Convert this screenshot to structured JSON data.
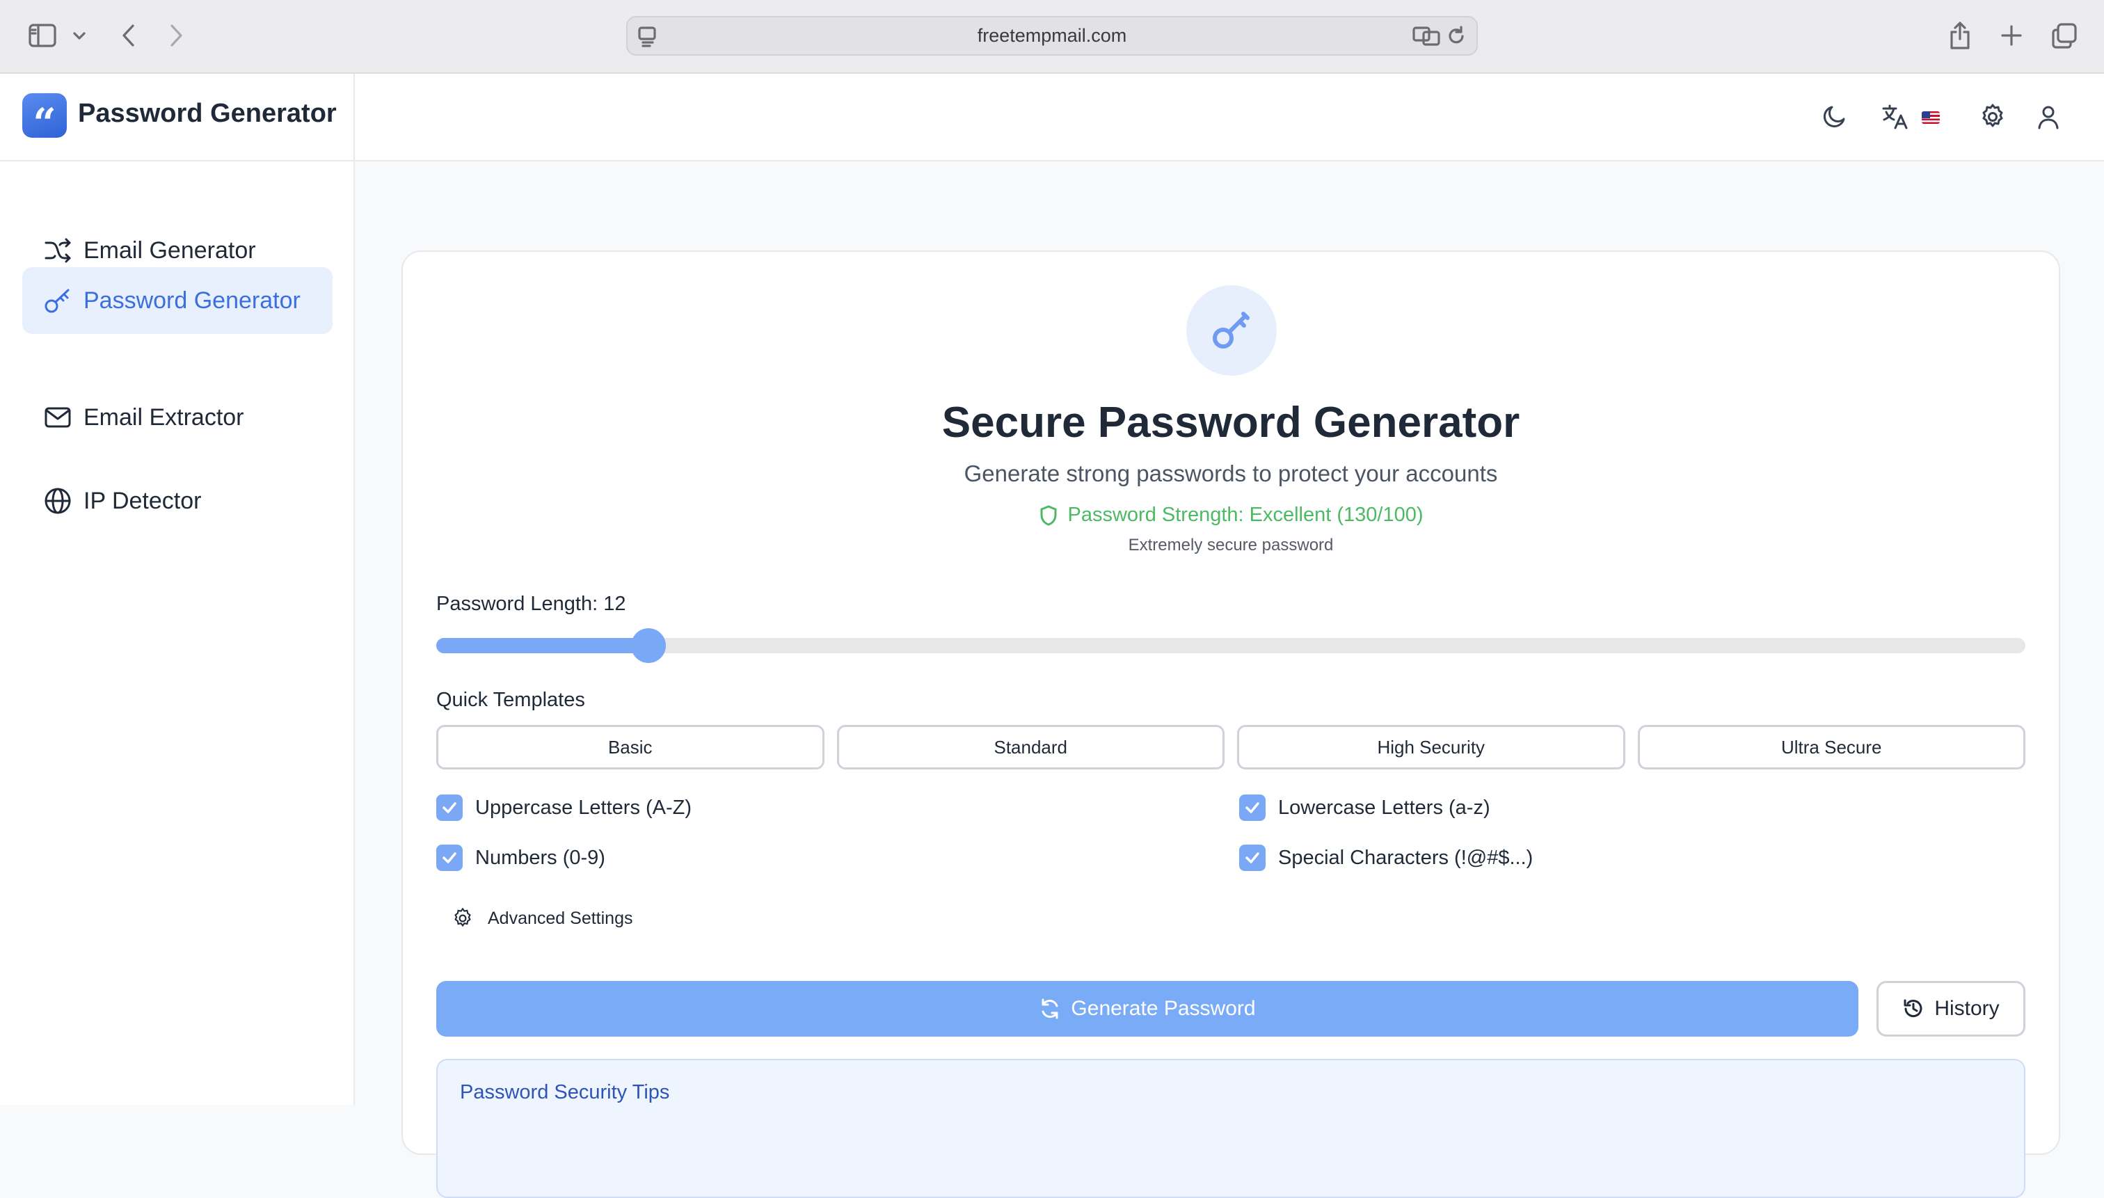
{
  "browser": {
    "url": "freetempmail.com"
  },
  "app": {
    "title": "Password Generator"
  },
  "header": {
    "icons": [
      "moon-icon",
      "translate-icon",
      "us-flag-icon",
      "gear-icon",
      "user-icon"
    ]
  },
  "sidebar": {
    "items": [
      {
        "label": "Email Generator",
        "icon": "shuffle-icon",
        "active": false
      },
      {
        "label": "Password Generator",
        "icon": "key-icon",
        "active": true
      },
      {
        "label": "Email Extractor",
        "icon": "mail-icon",
        "active": false
      },
      {
        "label": "IP Detector",
        "icon": "globe-icon",
        "active": false
      }
    ]
  },
  "main": {
    "title": "Secure Password Generator",
    "subtitle": "Generate strong passwords to protect your accounts",
    "strength_text": "Password Strength: Excellent (130/100)",
    "strength_note": "Extremely secure password",
    "strength_color": "#4cba62",
    "length_label": "Password Length: 12",
    "length_slider": {
      "value": 12,
      "min": 4,
      "max": 64
    },
    "templates_label": "Quick Templates",
    "templates": [
      "Basic",
      "Standard",
      "High Security",
      "Ultra Secure"
    ],
    "options": [
      {
        "label": "Uppercase Letters (A-Z)",
        "checked": true
      },
      {
        "label": "Lowercase Letters (a-z)",
        "checked": true
      },
      {
        "label": "Numbers (0-9)",
        "checked": true
      },
      {
        "label": "Special Characters (!@#$...)",
        "checked": true
      }
    ],
    "advanced_label": "Advanced Settings",
    "generate_label": "Generate Password",
    "history_label": "History",
    "tips_title": "Password Security Tips"
  },
  "colors": {
    "accent": "#3b6fe0",
    "button": "#7aabf7",
    "active_nav_bg": "#e8effd"
  }
}
